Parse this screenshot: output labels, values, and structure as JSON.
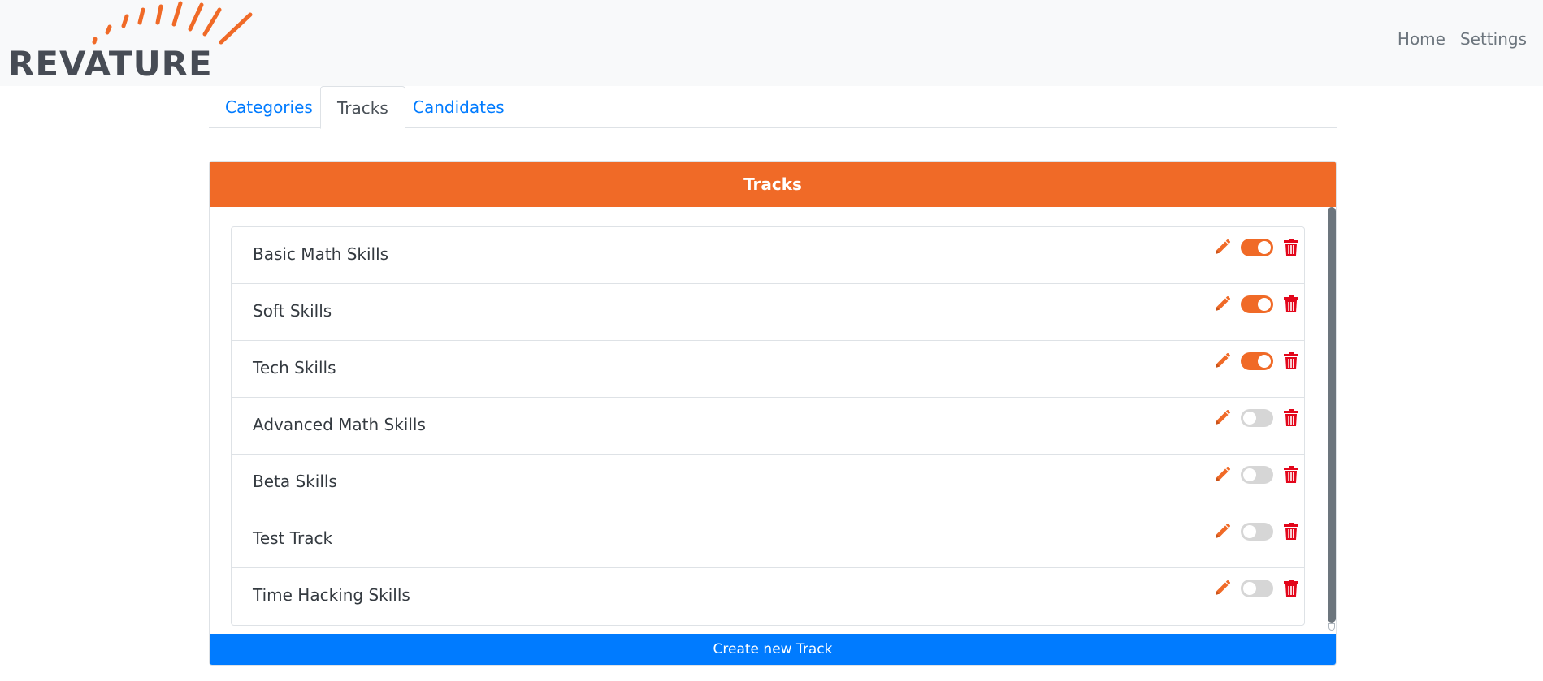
{
  "brand": {
    "logo_text": "REVATURE",
    "accent_color": "#f06a27",
    "logo_text_color": "#474c55"
  },
  "nav": {
    "links": [
      {
        "label": "Home"
      },
      {
        "label": "Settings"
      }
    ]
  },
  "tabs": [
    {
      "label": "Categories",
      "active": false
    },
    {
      "label": "Tracks",
      "active": true
    },
    {
      "label": "Candidates",
      "active": false
    }
  ],
  "card": {
    "header": "Tracks",
    "header_color": "#f06a27",
    "items": [
      {
        "label": "Basic Math Skills",
        "enabled": true
      },
      {
        "label": "Soft Skills",
        "enabled": true
      },
      {
        "label": "Tech Skills",
        "enabled": true
      },
      {
        "label": "Advanced Math Skills",
        "enabled": false
      },
      {
        "label": "Beta Skills",
        "enabled": false
      },
      {
        "label": "Test Track",
        "enabled": false
      },
      {
        "label": "Time Hacking Skills",
        "enabled": false
      }
    ],
    "item_icons": {
      "edit": "pencil-icon",
      "toggle": "toggle-switch",
      "delete": "trash-icon"
    },
    "create_button": "Create new Track",
    "create_button_color": "#007bff"
  }
}
